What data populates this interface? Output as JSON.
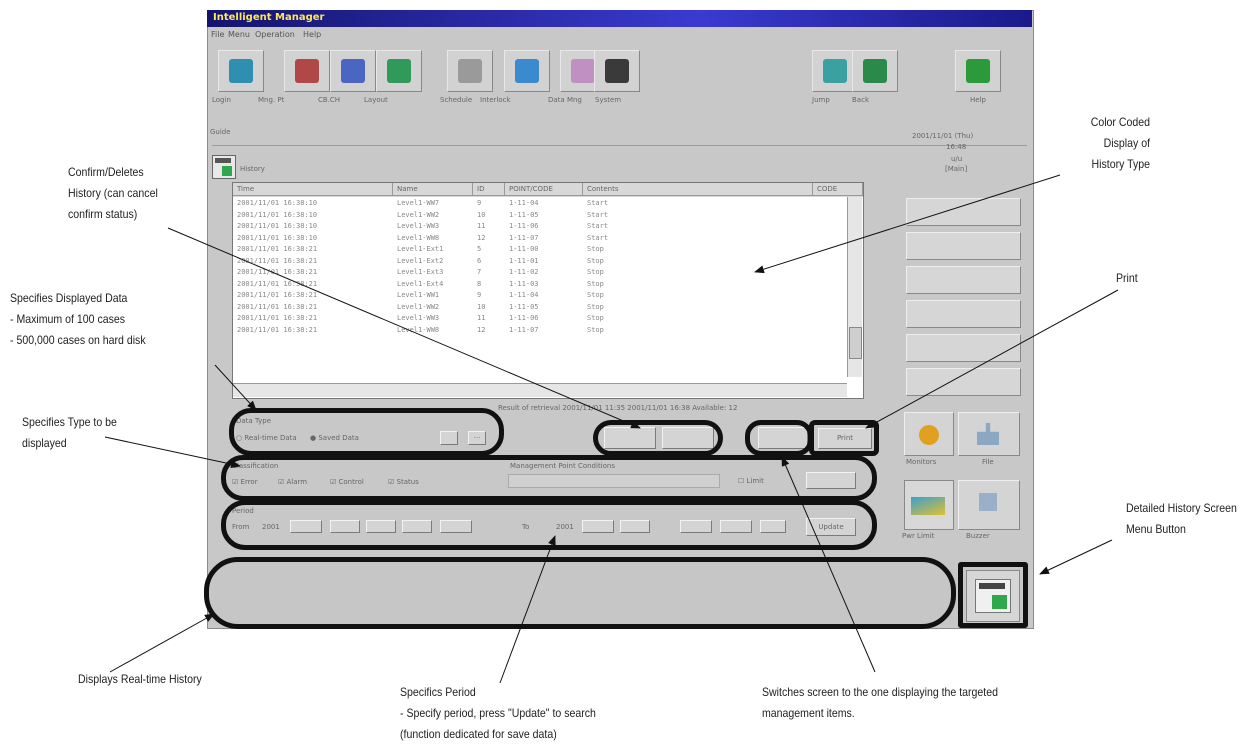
{
  "window": {
    "title": "Intelligent Manager",
    "menu": [
      "File",
      "Menu",
      "Operation",
      "Help"
    ],
    "guide_label": "Guide",
    "datetime": "2001/11/01 (Thu)",
    "time": "16:48",
    "status_line1": "u/u",
    "status_line2": "[Main]"
  },
  "toolbar": [
    {
      "label": "Login",
      "icon": "login-icon",
      "color": "#2f8fb0"
    },
    {
      "label": "Mng. Pt",
      "icon": "management-point-icon",
      "color": "#b04848"
    },
    {
      "label": "CB.CH",
      "icon": "cb-ch-icon",
      "color": "#4a66c0"
    },
    {
      "label": "Layout",
      "icon": "layout-icon",
      "color": "#2f9a5a"
    },
    {
      "label": "Schedule",
      "icon": "schedule-icon",
      "color": "#9a9a9a"
    },
    {
      "label": "Interlock",
      "icon": "interlock-icon",
      "color": "#3a8ad0"
    },
    {
      "label": "Data Mng",
      "icon": "data-management-icon",
      "color": "#c090c0"
    },
    {
      "label": "System",
      "icon": "system-icon",
      "color": "#3a3a3a"
    },
    {
      "label": "Jump",
      "icon": "jump-icon",
      "color": "#3aa0a0"
    },
    {
      "label": "Back",
      "icon": "back-icon",
      "color": "#2a8a4a"
    },
    {
      "label": "Help",
      "icon": "help-icon",
      "color": "#2a9a3a"
    }
  ],
  "history": {
    "tab_label": "History",
    "columns": [
      "Time",
      "Name",
      "ID",
      "POINT/CODE",
      "Contents",
      "CODE"
    ],
    "rows": [
      [
        "2001/11/01 16:38:10",
        "Level1-WW7",
        "9",
        "1-11-04",
        "Start"
      ],
      [
        "2001/11/01 16:38:10",
        "Level1-WW2",
        "10",
        "1-11-05",
        "Start"
      ],
      [
        "2001/11/01 16:38:10",
        "Level1-WW3",
        "11",
        "1-11-06",
        "Start"
      ],
      [
        "2001/11/01 16:38:10",
        "Level1-WW8",
        "12",
        "1-11-07",
        "Start"
      ],
      [
        "2001/11/01 16:38:21",
        "Level1-Ext1",
        "5",
        "1-11-00",
        "Stop"
      ],
      [
        "2001/11/01 16:38:21",
        "Level1-Ext2",
        "6",
        "1-11-01",
        "Stop"
      ],
      [
        "2001/11/01 16:38:21",
        "Level1-Ext3",
        "7",
        "1-11-02",
        "Stop"
      ],
      [
        "2001/11/01 16:38:21",
        "Level1-Ext4",
        "8",
        "1-11-03",
        "Stop"
      ],
      [
        "2001/11/01 16:38:21",
        "Level1-WW1",
        "9",
        "1-11-04",
        "Stop"
      ],
      [
        "2001/11/01 16:38:21",
        "Level1-WW2",
        "10",
        "1-11-05",
        "Stop"
      ],
      [
        "2001/11/01 16:38:21",
        "Level1-WW3",
        "11",
        "1-11-06",
        "Stop"
      ],
      [
        "2001/11/01 16:38:21",
        "Level1-WW8",
        "12",
        "1-11-07",
        "Stop"
      ]
    ],
    "result_text": "Result of retrieval 2001/11/01 11:35 2001/11/01 16:38  Available: 12",
    "data_type_label": "Data Type",
    "realtime_label": "Real-time Data",
    "saved_label": "Saved Data",
    "classification_label": "Classification",
    "classes": [
      "Error",
      "Alarm",
      "Control",
      "Status"
    ],
    "mgmt_cond_label": "Management Point Conditions",
    "limit_label": "Limit",
    "period_label": "Period",
    "from_label": "From",
    "to_label": "To",
    "from_year": "2001",
    "to_year": "2001",
    "update_label": "Update",
    "print_label": "Print",
    "side_labels": [
      "Monitors",
      "File",
      "Pwr Limit",
      "Buzzer"
    ]
  },
  "annotations": {
    "color_coded": [
      "Color Coded",
      "Display of",
      "History Type"
    ],
    "confirm_delete": [
      "Confirm/Deletes",
      "History (can cancel",
      "confirm status)"
    ],
    "displayed_data": [
      "Specifies Displayed Data",
      "- Maximum of 100 cases",
      "- 500,000 cases on hard disk"
    ],
    "type_displayed": [
      "Specifies Type to be",
      "displayed"
    ],
    "print": [
      "Print"
    ],
    "detailed_history": [
      "Detailed History Screen",
      "Menu Button"
    ],
    "realtime_history": [
      "Displays Real-time History"
    ],
    "period": [
      "Specifics Period",
      "- Specify period, press \"Update\" to search",
      "(function dedicated for save data)"
    ],
    "switches": [
      "Switches screen to the one displaying the targeted",
      "management items."
    ]
  }
}
